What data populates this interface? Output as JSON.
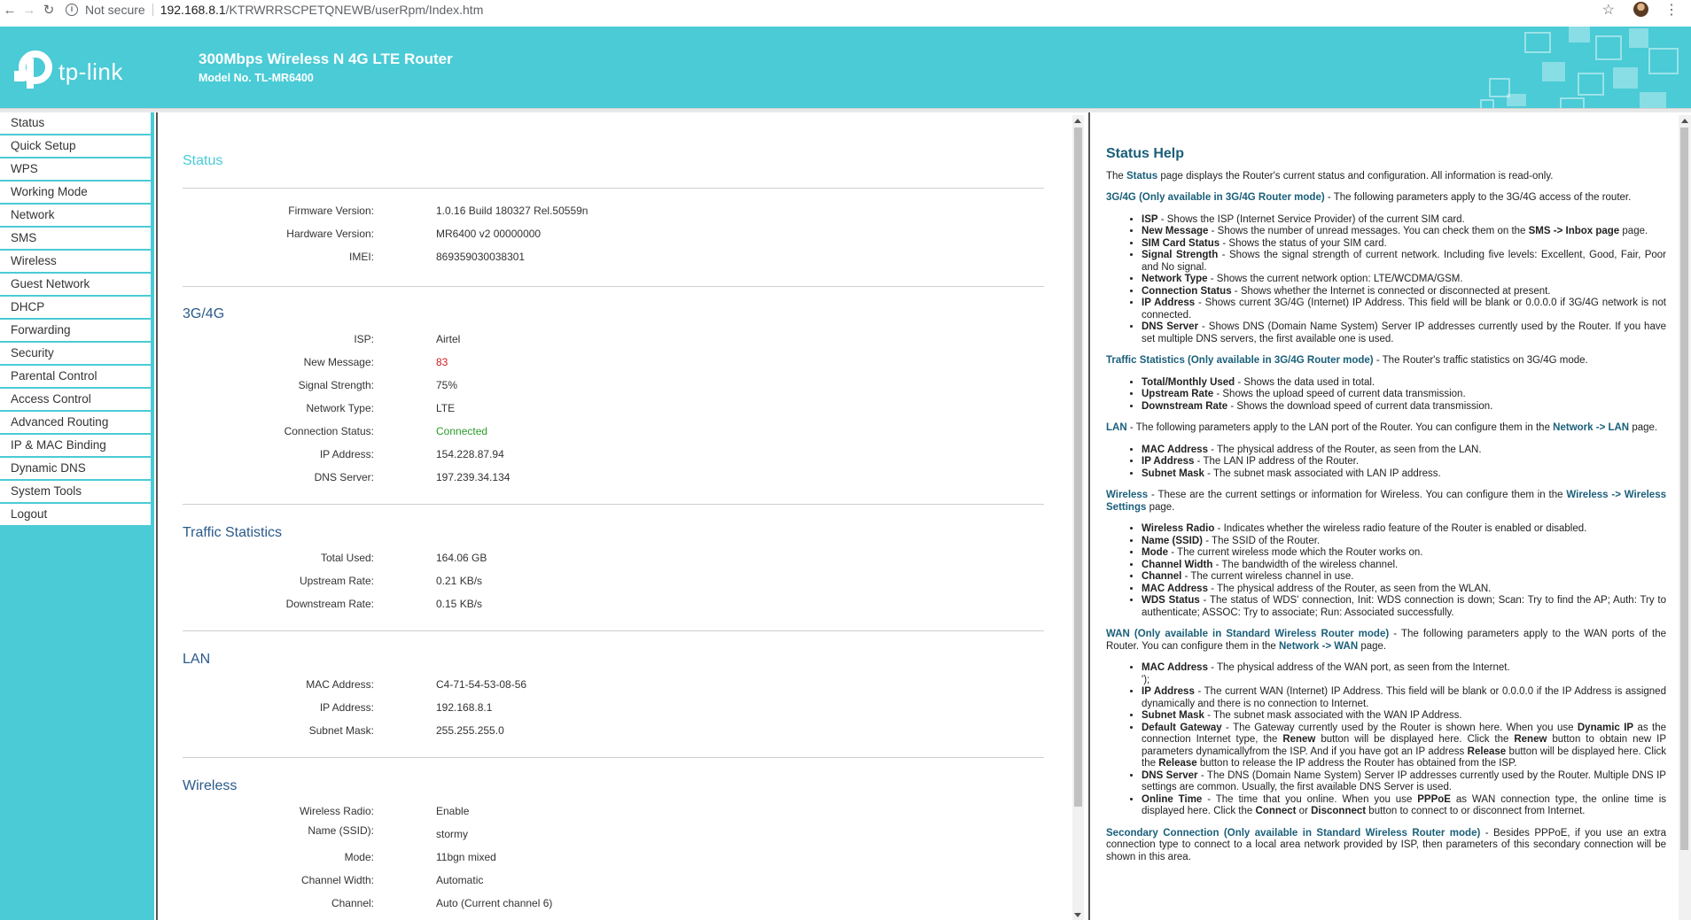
{
  "browser": {
    "not_secure": "Not secure",
    "url_host": "192.168.8.1",
    "url_path": "/KTRWRRSCPETQNEWB/userRpm/Index.htm"
  },
  "header": {
    "logo_text": "tp-link",
    "title": "300Mbps Wireless N 4G LTE Router",
    "model": "Model No. TL-MR6400",
    "accent_color": "#4acbd6"
  },
  "sidebar": {
    "items": [
      {
        "label": "Status"
      },
      {
        "label": "Quick Setup"
      },
      {
        "label": "WPS"
      },
      {
        "label": "Working Mode"
      },
      {
        "label": "Network"
      },
      {
        "label": "SMS"
      },
      {
        "label": "Wireless"
      },
      {
        "label": "Guest Network"
      },
      {
        "label": "DHCP"
      },
      {
        "label": "Forwarding"
      },
      {
        "label": "Security"
      },
      {
        "label": "Parental Control"
      },
      {
        "label": "Access Control"
      },
      {
        "label": "Advanced Routing"
      },
      {
        "label": "IP & MAC Binding"
      },
      {
        "label": "Dynamic DNS"
      },
      {
        "label": "System Tools"
      },
      {
        "label": "Logout"
      }
    ]
  },
  "status": {
    "title": "Status",
    "firmware_label": "Firmware Version:",
    "firmware": "1.0.16 Build 180327 Rel.50559n",
    "hardware_label": "Hardware Version:",
    "hardware": "MR6400 v2 00000000",
    "imei_label": "IMEI:",
    "imei": "869359030038301"
  },
  "g4": {
    "title": "3G/4G",
    "isp_label": "ISP:",
    "isp": "Airtel",
    "msg_label": "New Message:",
    "msg": "83",
    "signal_label": "Signal Strength:",
    "signal": "75%",
    "nettype_label": "Network Type:",
    "nettype": "LTE",
    "conn_label": "Connection Status:",
    "conn": "Connected",
    "ip_label": "IP Address:",
    "ip": "154.228.87.94",
    "dns_label": "DNS Server:",
    "dns": "197.239.34.134"
  },
  "traffic": {
    "title": "Traffic Statistics",
    "total_label": "Total Used:",
    "total": "164.06 GB",
    "up_label": "Upstream Rate:",
    "up": "0.21 KB/s",
    "down_label": "Downstream Rate:",
    "down": "0.15 KB/s"
  },
  "lan": {
    "title": "LAN",
    "mac_label": "MAC Address:",
    "mac": "C4-71-54-53-08-56",
    "ip_label": "IP Address:",
    "ip": "192.168.8.1",
    "mask_label": "Subnet Mask:",
    "mask": "255.255.255.0"
  },
  "wireless": {
    "title": "Wireless",
    "radio_label": "Wireless Radio:",
    "radio": "Enable",
    "ssid_label": "Name (SSID):",
    "ssid": "stormy",
    "mode_label": "Mode:",
    "mode": "11bgn mixed",
    "width_label": "Channel Width:",
    "width": "Automatic",
    "channel_label": "Channel:",
    "channel": "Auto (Current channel 6)"
  },
  "help": {
    "title": "Status Help"
  }
}
